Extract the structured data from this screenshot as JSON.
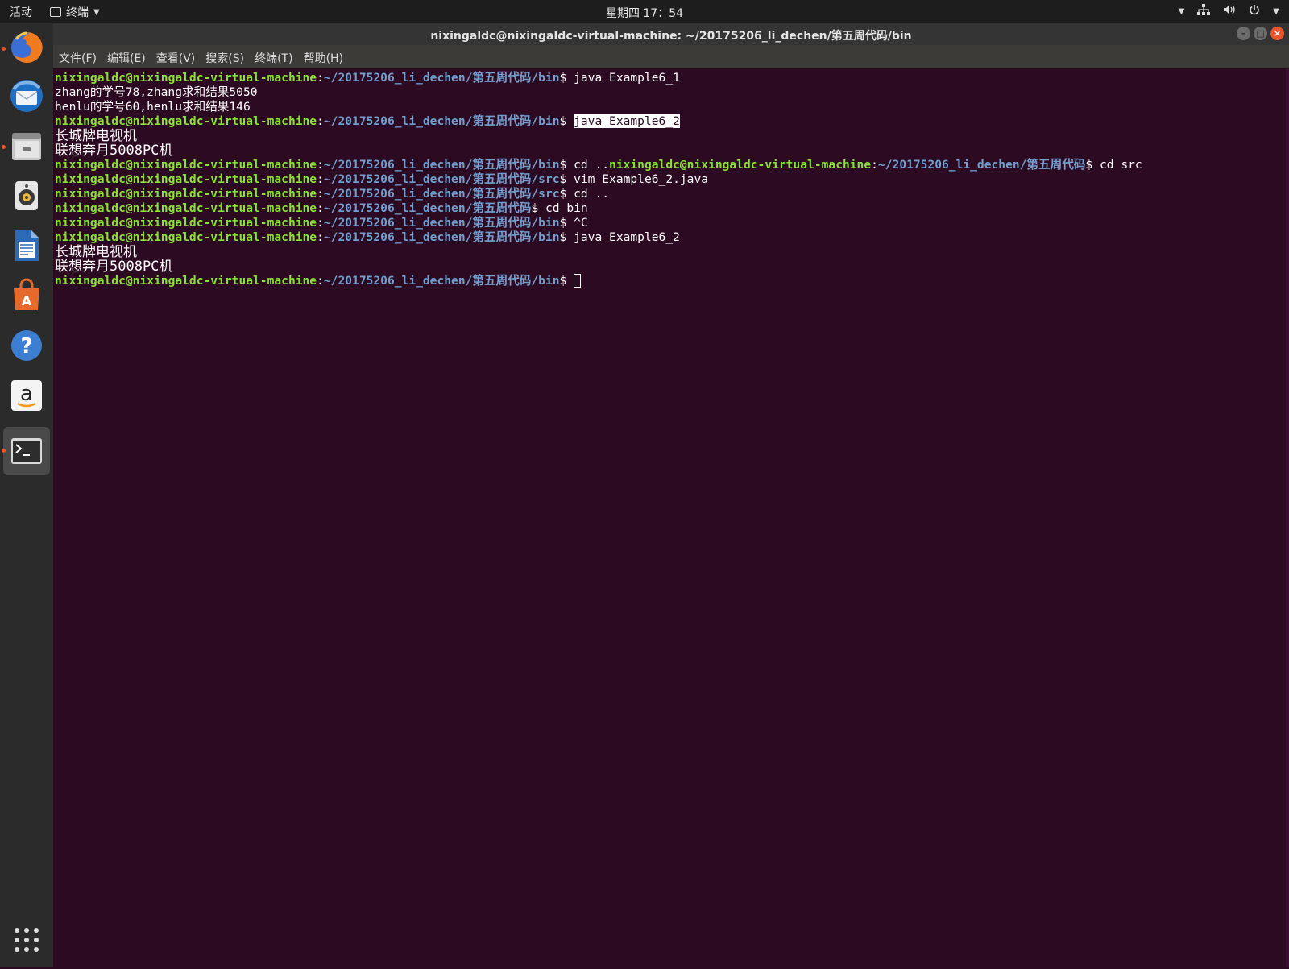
{
  "topbar": {
    "activities": "活动",
    "app_menu": "终端",
    "clock": "星期四 17：54",
    "icons": [
      "caret-down-icon",
      "network-icon",
      "volume-icon",
      "power-icon"
    ]
  },
  "window": {
    "title": "nixingaldc@nixingaldc-virtual-machine: ~/20175206_li_dechen/第五周代码/bin"
  },
  "menubar": {
    "items": [
      "文件(F)",
      "编辑(E)",
      "查看(V)",
      "搜索(S)",
      "终端(T)",
      "帮助(H)"
    ]
  },
  "launcher": {
    "items": [
      "firefox-icon",
      "thunderbird-icon",
      "files-icon",
      "rhythmbox-icon",
      "writer-icon",
      "software-center-icon",
      "help-icon",
      "amazon-icon",
      "terminal-icon"
    ],
    "show_apps": "show-applications-icon"
  },
  "prompt": {
    "user": "nixingaldc@nixingaldc-virtual-machine",
    "path_bin": "~/20175206_li_dechen/第五周代码/bin",
    "path_src": "~/20175206_li_dechen/第五周代码/src",
    "path_root": "~/20175206_li_dechen/第五周代码",
    "colon": ":",
    "dollar": "$"
  },
  "terminal": {
    "l1_cmd": " java Example6_1",
    "l2": "zhang的学号78,zhang求和结果5050",
    "l3": "henlu的学号60,henlu求和结果146",
    "l4_cmd": "java Example6_2",
    "l5": "长城牌电视机",
    "l6": "联想奔月5008PC机",
    "l7_cmd_a": " cd ..",
    "l7_cmd_b": " cd src",
    "l8_cmd": " vim Example6_2.java",
    "l9_cmd": " cd ..",
    "l10_cmd": " cd bin",
    "l11_cmd": " ^C",
    "l12_cmd": " java Example6_2",
    "l13": "长城牌电视机",
    "l14": "联想奔月5008PC机"
  },
  "colors": {
    "terminal_bg": "#2c0a22",
    "user_green": "#8ae234",
    "path_blue": "#729fcf",
    "close_orange": "#e9542b"
  }
}
